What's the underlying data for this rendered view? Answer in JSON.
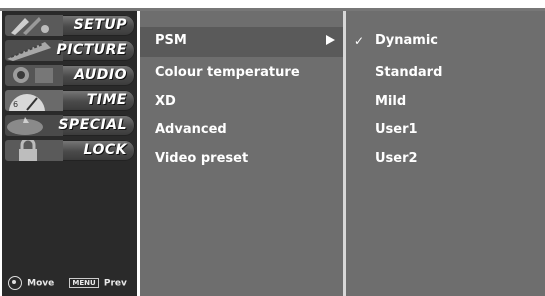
{
  "sidebar": {
    "tabs": [
      {
        "label": "SETUP",
        "icon": "tools-icon"
      },
      {
        "label": "PICTURE",
        "icon": "film-icon"
      },
      {
        "label": "AUDIO",
        "icon": "speaker-icon"
      },
      {
        "label": "TIME",
        "icon": "clock-icon"
      },
      {
        "label": "SPECIAL",
        "icon": "special-icon"
      },
      {
        "label": "LOCK",
        "icon": "lock-icon"
      }
    ],
    "footer": {
      "move_label": "Move",
      "menu_key": "MENU",
      "prev_label": "Prev"
    }
  },
  "submenu": {
    "items": [
      "PSM",
      "Colour temperature",
      "XD",
      "Advanced",
      "Video preset"
    ],
    "selected_index": 0
  },
  "options": {
    "items": [
      "Dynamic",
      "Standard",
      "Mild",
      "User1",
      "User2"
    ],
    "checked_index": 0,
    "check_mark": "✓"
  },
  "colors": {
    "panel": "#6e6e6e",
    "sidebar": "#2a2a2a",
    "text": "#ffffff"
  }
}
